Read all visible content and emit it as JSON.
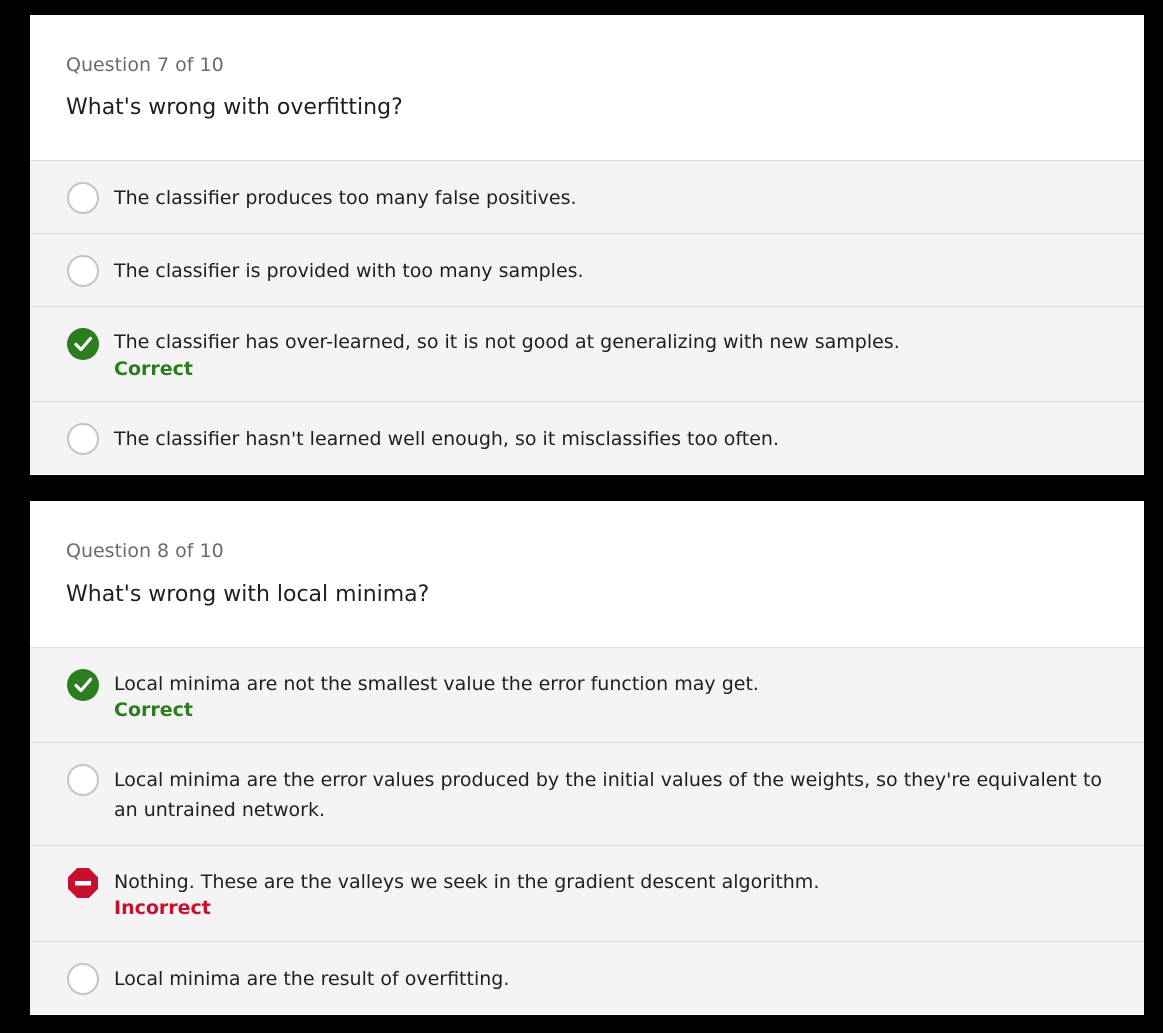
{
  "questions": [
    {
      "counter": "Question 7 of 10",
      "text": "What's wrong with overfitting?",
      "options": [
        {
          "text": "The classifier produces too many false positives.",
          "state": "unselected",
          "status": ""
        },
        {
          "text": "The classifier is provided with too many samples.",
          "state": "unselected",
          "status": ""
        },
        {
          "text": "The classifier has over-learned, so it is not good at generalizing with new samples.",
          "state": "correct",
          "status": "Correct"
        },
        {
          "text": "The classifier hasn't learned well enough, so it misclassifies too often.",
          "state": "unselected",
          "status": ""
        }
      ]
    },
    {
      "counter": "Question 8 of 10",
      "text": "What's wrong with local minima?",
      "options": [
        {
          "text": "Local minima are not the smallest value the error function may get.",
          "state": "correct",
          "status": "Correct"
        },
        {
          "text": "Local minima are the error values produced by the initial values of the weights, so they're equivalent to an untrained network.",
          "state": "unselected",
          "status": ""
        },
        {
          "text": "Nothing. These are the valleys we seek in the gradient descent algorithm.",
          "state": "incorrect",
          "status": "Incorrect"
        },
        {
          "text": "Local minima are the result of overfitting.",
          "state": "unselected",
          "status": ""
        }
      ]
    }
  ],
  "colors": {
    "correct": "#2b7d1f",
    "incorrect": "#c8102e",
    "background": "#000000",
    "option_bg": "#f4f4f4"
  },
  "icons": {
    "unselected": "radio-circle-icon",
    "correct": "checkmark-circle-icon",
    "incorrect": "stop-sign-icon"
  }
}
